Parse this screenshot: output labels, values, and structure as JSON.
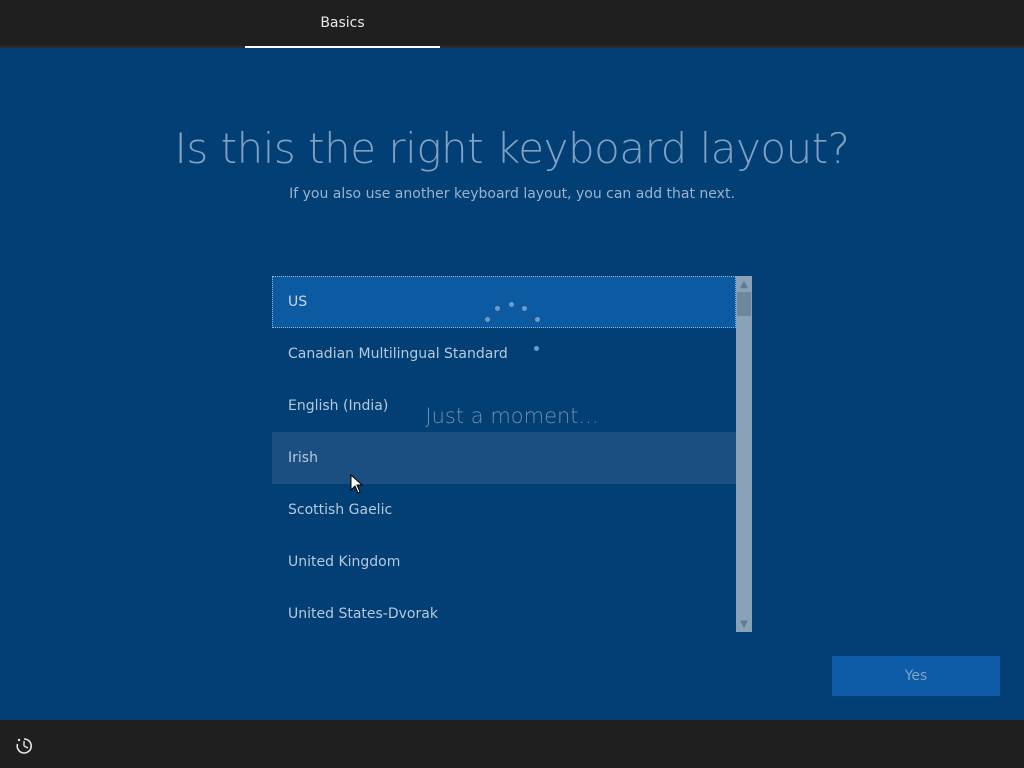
{
  "header": {
    "tab_label": "Basics"
  },
  "main": {
    "title": "Is this the right keyboard layout?",
    "subtitle": "If you also use another keyboard layout, you can add that next.",
    "layouts": [
      "US",
      "Canadian Multilingual Standard",
      "English (India)",
      "Irish",
      "Scottish Gaelic",
      "United Kingdom",
      "United States-Dvorak"
    ],
    "selected_layout": "US",
    "loading_text": "Just a moment...",
    "yes_label": "Yes"
  },
  "footer": {
    "icon": "accessibility-icon"
  },
  "colors": {
    "background": "#023f74",
    "topbar": "#1f1f1f",
    "selected": "#0b5aa2",
    "button": "#0c5ca7"
  }
}
